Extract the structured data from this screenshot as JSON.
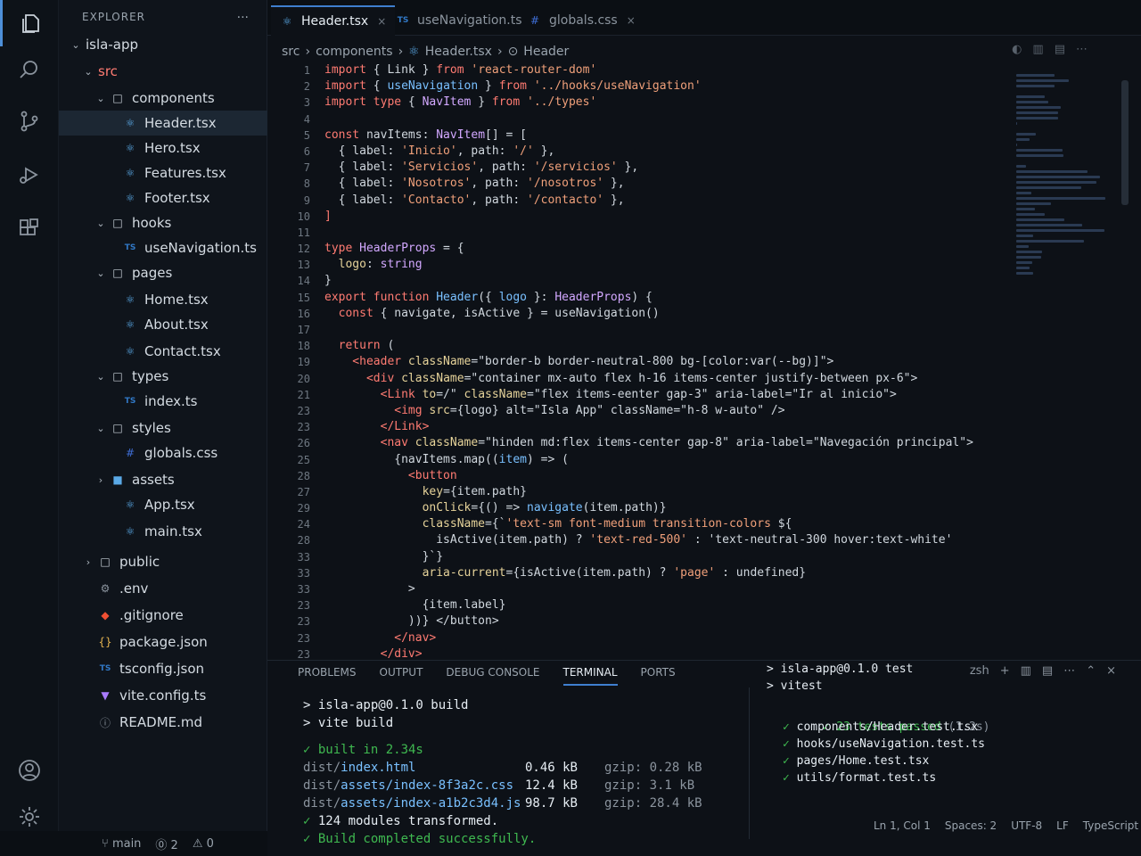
{
  "explorer": {
    "header": "EXPLORER",
    "more": "...",
    "tree": [
      {
        "label": "isla-app",
        "indent": 0,
        "chev": "⌄",
        "icon": "",
        "color": ""
      },
      {
        "label": "src",
        "indent": 1,
        "chev": "⌄",
        "icon": "",
        "color": "#ff7b72"
      },
      {
        "label": "components",
        "indent": 2,
        "chev": "⌄",
        "icon": "folder",
        "color": ""
      },
      {
        "label": "Header.tsx",
        "indent": 3,
        "chev": "",
        "icon": "react",
        "color": "",
        "selected": true
      },
      {
        "label": "Hero.tsx",
        "indent": 3,
        "chev": "",
        "icon": "react",
        "color": ""
      },
      {
        "label": "Features.tsx",
        "indent": 3,
        "chev": "",
        "icon": "react",
        "color": ""
      },
      {
        "label": "Footer.tsx",
        "indent": 3,
        "chev": "",
        "icon": "react",
        "color": ""
      },
      {
        "label": "hooks",
        "indent": 2,
        "chev": "⌄",
        "icon": "folder",
        "color": ""
      },
      {
        "label": "useNavigation.ts",
        "indent": 3,
        "chev": "",
        "icon": "ts",
        "color": ""
      },
      {
        "label": "pages",
        "indent": 2,
        "chev": "⌄",
        "icon": "folder",
        "color": ""
      },
      {
        "label": "Home.tsx",
        "indent": 3,
        "chev": "",
        "icon": "react",
        "color": ""
      },
      {
        "label": "About.tsx",
        "indent": 3,
        "chev": "",
        "icon": "react",
        "color": ""
      },
      {
        "label": "Contact.tsx",
        "indent": 3,
        "chev": "",
        "icon": "react",
        "color": ""
      },
      {
        "label": "types",
        "indent": 2,
        "chev": "⌄",
        "icon": "folder",
        "color": ""
      },
      {
        "label": "index.ts",
        "indent": 3,
        "chev": "",
        "icon": "ts",
        "color": ""
      },
      {
        "label": "styles",
        "indent": 2,
        "chev": "⌄",
        "icon": "folder",
        "color": ""
      },
      {
        "label": "globals.css",
        "indent": 3,
        "chev": "",
        "icon": "css",
        "color": ""
      },
      {
        "label": "assets",
        "indent": 2,
        "chev": "›",
        "icon": "folder-filled",
        "color": ""
      },
      {
        "label": "App.tsx",
        "indent": 3,
        "chev": "",
        "icon": "react",
        "color": ""
      },
      {
        "label": "main.tsx",
        "indent": 3,
        "chev": "",
        "icon": "react",
        "color": ""
      },
      {
        "label": "public",
        "indent": 1,
        "chev": "›",
        "icon": "folder",
        "color": ""
      },
      {
        "label": ".env",
        "indent": 1,
        "chev": "",
        "icon": "gear",
        "color": ""
      },
      {
        "label": ".gitignore",
        "indent": 1,
        "chev": "",
        "icon": "git",
        "color": ""
      },
      {
        "label": "package.json",
        "indent": 1,
        "chev": "",
        "icon": "json",
        "color": ""
      },
      {
        "label": "tsconfig.json",
        "indent": 1,
        "chev": "",
        "icon": "ts",
        "color": ""
      },
      {
        "label": "vite.config.ts",
        "indent": 1,
        "chev": "",
        "icon": "vite",
        "color": ""
      },
      {
        "label": "README.md",
        "indent": 1,
        "chev": "",
        "icon": "info",
        "color": ""
      }
    ]
  },
  "tabs": [
    {
      "label": "Header.tsx",
      "icon": "react",
      "close": "×",
      "active": true
    },
    {
      "label": "useNavigation.ts",
      "icon": "ts",
      "close": "",
      "active": false
    },
    {
      "label": "globals.css",
      "icon": "css",
      "close": "×",
      "active": false
    }
  ],
  "breadcrumb": [
    "src",
    "components",
    "Header.tsx",
    "Header"
  ],
  "gutter": [
    "1",
    "2",
    "3",
    "4",
    "5",
    "6",
    "7",
    "8",
    "9",
    "10",
    "11",
    "12",
    "13",
    "14",
    "15",
    "16",
    "17",
    "18",
    "19",
    "20",
    "21",
    "23",
    "23",
    "26",
    "25",
    "28",
    "27",
    "29",
    "24",
    "28",
    "33",
    "33",
    "33",
    "23",
    "23",
    "23",
    "23",
    "28"
  ],
  "code": [
    [
      [
        "kw",
        "import"
      ],
      [
        "pl",
        " { Link } "
      ],
      [
        "kw",
        "from"
      ],
      [
        "str",
        " 'react-router-dom'"
      ]
    ],
    [
      [
        "kw",
        "import"
      ],
      [
        "pl",
        " { "
      ],
      [
        "fn",
        "useNavigation"
      ],
      [
        "pl",
        " } "
      ],
      [
        "kw",
        "from"
      ],
      [
        "str",
        " '../hooks/useNavigation'"
      ]
    ],
    [
      [
        "kw",
        "import"
      ],
      [
        "kw",
        " type"
      ],
      [
        "pl",
        " { "
      ],
      [
        "ty",
        "NavItem"
      ],
      [
        "pl",
        " } "
      ],
      [
        "kw",
        "from"
      ],
      [
        "str",
        " '../types'"
      ]
    ],
    [],
    [
      [
        "kw",
        "const"
      ],
      [
        "pl",
        " navItems: "
      ],
      [
        "ty",
        "NavItem"
      ],
      [
        "pl",
        "[] = ["
      ]
    ],
    [
      [
        "pl",
        "  { label: "
      ],
      [
        "str",
        "'Inicio'"
      ],
      [
        "pl",
        ", path: "
      ],
      [
        "str",
        "'/'"
      ],
      [
        "pl",
        " },"
      ]
    ],
    [
      [
        "pl",
        "  { label: "
      ],
      [
        "str",
        "'Servicios'"
      ],
      [
        "pl",
        ", path: "
      ],
      [
        "str",
        "'/servicios'"
      ],
      [
        "pl",
        " },"
      ]
    ],
    [
      [
        "pl",
        "  { label: "
      ],
      [
        "str",
        "'Nosotros'"
      ],
      [
        "pl",
        ", path: "
      ],
      [
        "str",
        "'/nosotros'"
      ],
      [
        "pl",
        " },"
      ]
    ],
    [
      [
        "pl",
        "  { label: "
      ],
      [
        "str",
        "'Contacto'"
      ],
      [
        "pl",
        ", path: "
      ],
      [
        "str",
        "'/contacto'"
      ],
      [
        "pl",
        " },"
      ]
    ],
    [
      [
        "kw",
        "]"
      ]
    ],
    [],
    [
      [
        "kw",
        "type"
      ],
      [
        "ty",
        " HeaderProps"
      ],
      [
        "pl",
        " = {"
      ]
    ],
    [
      [
        "attr",
        "  logo"
      ],
      [
        "pl",
        ": "
      ],
      [
        "ty",
        "string"
      ]
    ],
    [
      [
        "pl",
        "}"
      ]
    ],
    [
      [
        "kw",
        "export function"
      ],
      [
        "fn",
        " Header"
      ],
      [
        "pl",
        "({ "
      ],
      [
        "fn",
        "logo"
      ],
      [
        "pl",
        " }: "
      ],
      [
        "ty",
        "HeaderProps"
      ],
      [
        "pl",
        ") {"
      ]
    ],
    [
      [
        "kw",
        "  const"
      ],
      [
        "pl",
        " { navigate, isActive } = useNavigation()"
      ]
    ],
    [],
    [
      [
        "kw",
        "  return"
      ],
      [
        "pl",
        " ("
      ]
    ],
    [
      [
        "tag",
        "    <header"
      ],
      [
        "attr",
        " className"
      ],
      [
        "pl",
        "=\"border-b border-neutral-800 bg-[color:var(--bg)]\">"
      ]
    ],
    [
      [
        "tag",
        "      <div"
      ],
      [
        "attr",
        " className"
      ],
      [
        "pl",
        "=\"container mx-auto flex h-16 items-center justify-between px-6\">"
      ]
    ],
    [
      [
        "tag",
        "        <Link"
      ],
      [
        "attr",
        " to"
      ],
      [
        "pl",
        "=/\" "
      ],
      [
        "attr",
        "className"
      ],
      [
        "pl",
        "=\"flex items-eenter gap-3\" aria-label=\"Ir al inicio\">"
      ]
    ],
    [
      [
        "tag",
        "          <img"
      ],
      [
        "attr",
        " src"
      ],
      [
        "pl",
        "={logo} alt=\"Isla App\" className=\"h-8 w-auto\" />"
      ]
    ],
    [
      [
        "tag",
        "        </Link>"
      ]
    ],
    [
      [
        "tag",
        "        <nav"
      ],
      [
        "attr",
        " className"
      ],
      [
        "pl",
        "=\"hinden md:flex items-center gap-8\" aria-label=\"Navegación principal\">"
      ]
    ],
    [
      [
        "pl",
        "          {navItems.map(("
      ],
      [
        "fn",
        "item"
      ],
      [
        "pl",
        ") => ("
      ]
    ],
    [
      [
        "tag",
        "            <button"
      ]
    ],
    [
      [
        "attr",
        "              key"
      ],
      [
        "pl",
        "={item.path}"
      ]
    ],
    [
      [
        "attr",
        "              onClick"
      ],
      [
        "pl",
        "={() => "
      ],
      [
        "fn",
        "navigate"
      ],
      [
        "pl",
        "(item.path)}"
      ]
    ],
    [
      [
        "attr",
        "              className"
      ],
      [
        "pl",
        "={`"
      ],
      [
        "str",
        "'text-sm font-medium transition-colors"
      ],
      [
        "pl",
        " ${"
      ]
    ],
    [
      [
        "pl",
        "                isActive(item.path) ? "
      ],
      [
        "str",
        "'text-red-500'"
      ],
      [
        "pl",
        " : 'text-neutral-300 hover:text-white'"
      ]
    ],
    [
      [
        "pl",
        "              }`}"
      ]
    ],
    [
      [
        "attr",
        "              aria-current"
      ],
      [
        "pl",
        "={isActive(item.path) ? "
      ],
      [
        "str",
        "'page'"
      ],
      [
        "pl",
        " : undefined}"
      ]
    ],
    [
      [
        "pl",
        "            >"
      ]
    ],
    [
      [
        "pl",
        "              {item.label}"
      ]
    ],
    [
      [
        "pl",
        "            ))} </button>"
      ]
    ],
    [
      [
        "tag",
        "          </nav>"
      ]
    ],
    [
      [
        "tag",
        "        </div>"
      ]
    ],
    [
      [
        "pl",
        "      ) "
      ],
      [
        "tag",
        "</header>"
      ]
    ]
  ],
  "panel": {
    "tabs": [
      "PROBLEMS",
      "OUTPUT",
      "DEBUG CONSOLE",
      "TERMINAL",
      "PORTS"
    ],
    "active_tab": "TERMINAL",
    "shell": "zsh",
    "build": {
      "cmd1": "> isla-app@0.1.0 build",
      "cmd2": "> vite build",
      "built": "built in 2.34s",
      "assets": [
        {
          "path_pre": "dist/",
          "path": "index.html",
          "size": "0.46 kB",
          "gzip": "gzip: 0.28 kB"
        },
        {
          "path_pre": "dist/",
          "path": "assets/index-8f3a2c.css",
          "size": "12.4 kB",
          "gzip": "gzip: 3.1 kB"
        },
        {
          "path_pre": "dist/",
          "path": "assets/index-a1b2c3d4.js",
          "size": "98.7 kB",
          "gzip": "gzip: 28.4 kB"
        }
      ],
      "modules": "124 modules transformed.",
      "done": "Build completed successfully."
    },
    "test": {
      "cmd1": "> isla-app@0.1.0 test",
      "cmd2": "> vitest",
      "passed": "23 tests passed",
      "time": "(1.2s)",
      "files": [
        "components/Header.test.tsx",
        "hooks/useNavigation.test.ts",
        "pages/Home.test.tsx",
        "utils/format.test.ts"
      ]
    }
  },
  "status": {
    "branch": "main",
    "problems": "⓪ 2",
    "warnings": "⚠ 0",
    "position": "Ln 1, Col 1",
    "spaces": "Spaces: 2",
    "encoding": "UTF-8",
    "eol": "LF",
    "language": "TypeScript JSX"
  },
  "colors": {
    "accent": "#3f7fcf",
    "react": "#5aa9e6",
    "ts": "#3178c6",
    "css": "#3f6fd8",
    "ok": "#3fb950"
  }
}
